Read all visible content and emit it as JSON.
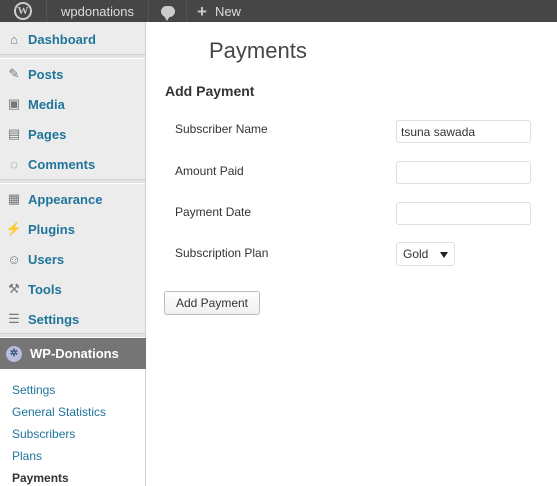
{
  "adminbar": {
    "site_name": "wpdonations",
    "new_label": "New",
    "logo_letter": "W"
  },
  "sidebar": {
    "items": [
      {
        "label": "Dashboard",
        "icon": "home-icon"
      },
      {
        "label": "Posts",
        "icon": "pin-icon"
      },
      {
        "label": "Media",
        "icon": "media-icon"
      },
      {
        "label": "Pages",
        "icon": "pages-icon"
      },
      {
        "label": "Comments",
        "icon": "comment-icon"
      },
      {
        "label": "Appearance",
        "icon": "appearance-icon"
      },
      {
        "label": "Plugins",
        "icon": "plugin-icon"
      },
      {
        "label": "Users",
        "icon": "users-icon"
      },
      {
        "label": "Tools",
        "icon": "tools-icon"
      },
      {
        "label": "Settings",
        "icon": "settings-icon"
      }
    ],
    "active": {
      "label": "WP-Donations",
      "icon": "gear-icon"
    },
    "submenu": [
      {
        "label": "Settings"
      },
      {
        "label": "General Statistics"
      },
      {
        "label": "Subscribers"
      },
      {
        "label": "Plans"
      },
      {
        "label": "Payments"
      }
    ]
  },
  "main": {
    "page_title": "Payments",
    "section_title": "Add Payment",
    "form": {
      "subscriber_name_label": "Subscriber Name",
      "subscriber_name_value": "tsuna sawada",
      "amount_paid_label": "Amount Paid",
      "amount_paid_value": "",
      "payment_date_label": "Payment Date",
      "payment_date_value": "",
      "plan_label": "Subscription Plan",
      "plan_selected": "Gold",
      "submit_label": "Add Payment"
    }
  },
  "colors": {
    "adminbar_bg": "#464646",
    "link": "#21759b",
    "active_menu_bg": "#757575"
  }
}
